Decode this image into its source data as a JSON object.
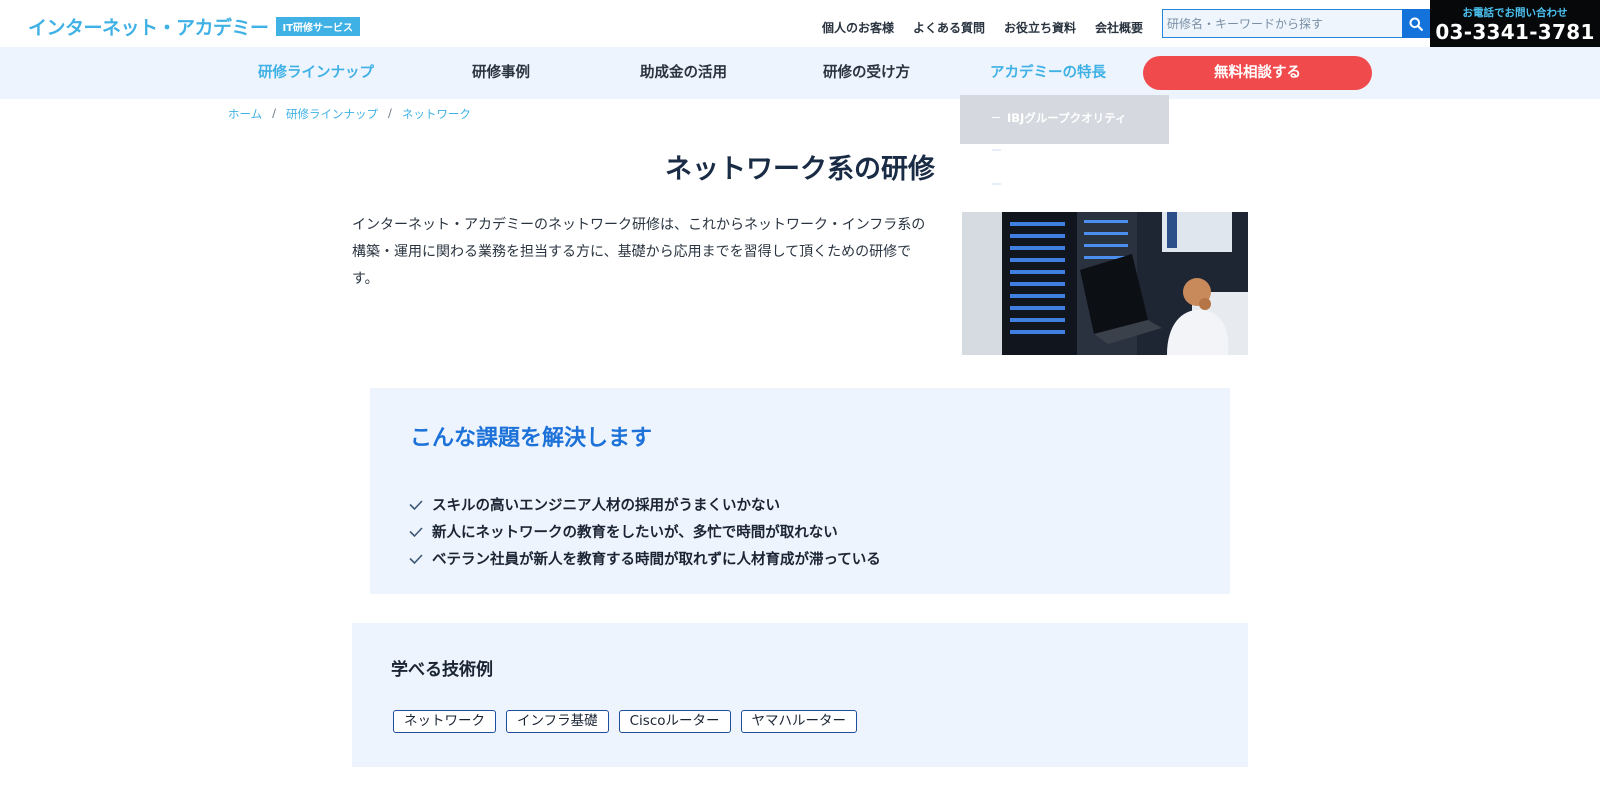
{
  "header": {
    "logo_text": "インターネット・アカデミー",
    "logo_badge": "IT研修サービス",
    "util_links": [
      "個人のお客様",
      "よくある質問",
      "お役立ち資料",
      "会社概要"
    ],
    "search_placeholder": "研修名・キーワードから探す",
    "phone_lead": "お電話でお問い合わせ",
    "phone_number": "03-3341-3781"
  },
  "nav": {
    "items": [
      "研修ラインナップ",
      "研修事例",
      "助成金の活用",
      "研修の受け方",
      "アカデミーの特長"
    ],
    "active_index": 0,
    "cta_label": "無料相談する",
    "dropdown_item": "IBJグループクオリティ"
  },
  "breadcrumb": [
    "ホーム",
    "研修ラインナップ",
    "ネットワーク"
  ],
  "main": {
    "title": "ネットワーク系の研修",
    "intro": "インターネット・アカデミーのネットワーク研修は、これからネットワーク・インフラ系の構築・運用に関わる業務を担当する方に、基礎から応用までを習得して頂くための研修です。",
    "hero_image": "data-center-engineers-photo"
  },
  "problems": {
    "heading": "こんな課題を解決します",
    "items": [
      "スキルの高いエンジニア人材の採用がうまくいかない",
      "新人にネットワークの教育をしたいが、多忙で時間が取れない",
      "ベテラン社員が新人を教育する時間が取れずに人材育成が滞っている"
    ]
  },
  "tech": {
    "heading": "学べる技術例",
    "tags": [
      "ネットワーク",
      "インフラ基礎",
      "Ciscoルーター",
      "ヤマハルーター"
    ]
  },
  "colors": {
    "brand": "#3fb1e5",
    "nav_bg": "#eef4fd",
    "cta": "#f04a4c",
    "heading_blue": "#1c72d8",
    "search_button": "#1472db"
  }
}
